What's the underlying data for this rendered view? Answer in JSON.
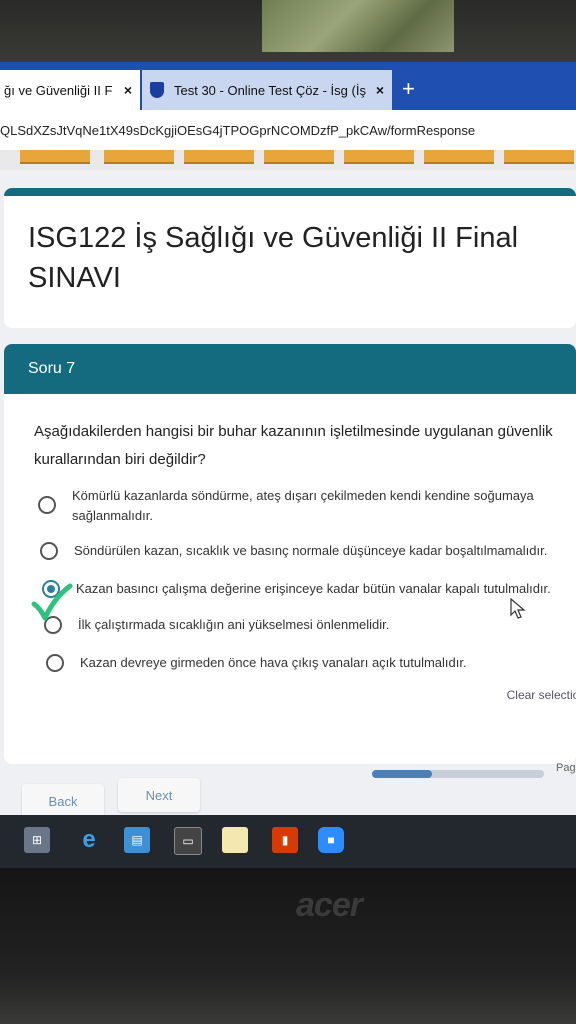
{
  "browser": {
    "tabs": [
      {
        "label": "ğı ve Güvenliği II F",
        "close": "×"
      },
      {
        "label": "Test 30 - Online Test Çöz - İsg (İş",
        "close": "×"
      }
    ],
    "new_tab": "+",
    "url": "QLSdXZsJtVqNe1tX49sDcKgjiOEsG4jTPOGprNCOMDzfP_pkCAw/formResponse"
  },
  "form": {
    "title_line1": "ISG122 İş Sağlığı ve Güvenliği II Final",
    "title_line2": "SINAVI",
    "section": "Soru 7",
    "question_line1": "Aşağıdakilerden hangisi bir buhar kazanının işletilmesinde uygulanan güvenlik",
    "question_line2": "kurallarından biri değildir?",
    "options": [
      {
        "line1": "Kömürlü kazanlarda söndürme, ateş dışarı çekilmeden kendi kendine soğumaya",
        "line2": "sağlanmalıdır."
      },
      {
        "line1": "Söndürülen kazan, sıcaklık ve basınç normale düşünceye kadar boşaltılmamalıdır."
      },
      {
        "line1": "Kazan basıncı çalışma değerine erişinceye kadar bütün vanalar kapalı tutulmalıdır."
      },
      {
        "line1": "İlk çalıştırmada sıcaklığın ani yükselmesi önlenmelidir."
      },
      {
        "line1": "Kazan devreye girmeden önce hava çıkış vanaları açık tutulmalıdır."
      }
    ],
    "selected_option": 3,
    "clear_label": "Clear selection",
    "back_label": "Back",
    "next_label": "Next",
    "page_label": "Page",
    "progress_fraction": 0.35
  },
  "colors": {
    "accent": "#146b80",
    "check": "#2ec27e"
  },
  "taskbar_icons": [
    "windows-icon",
    "internet-explorer-icon",
    "store-icon",
    "file-explorer-icon",
    "photos-icon",
    "office-icon",
    "zoom-icon"
  ],
  "laptop_brand": "acer"
}
